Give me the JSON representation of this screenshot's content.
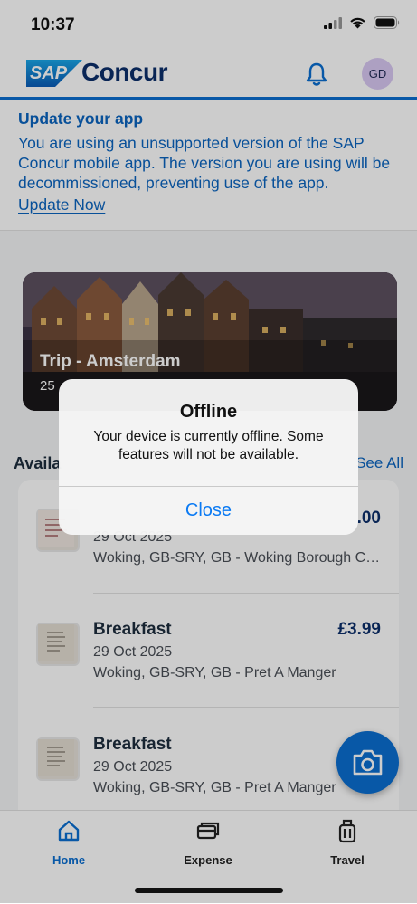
{
  "status_bar": {
    "time": "10:37"
  },
  "header": {
    "brand": "Concur",
    "logo_text": "SAP",
    "avatar_initials": "GD"
  },
  "banner": {
    "title": "Update your app",
    "body": "You are using an unsupported version of the SAP Concur mobile app. The version you are using will be decommissioned, preventing use of the app.",
    "link": "Update Now"
  },
  "trip": {
    "title": "Trip - Amsterdam",
    "date_partial": "25"
  },
  "available": {
    "title_partial": "Availa",
    "see_all": "See All"
  },
  "expenses": [
    {
      "title": "",
      "date": "29 Oct 2025",
      "location": "Woking, GB-SRY, GB - Woking Borough Council",
      "amount": ".00"
    },
    {
      "title": "Breakfast",
      "date": "29 Oct 2025",
      "location": "Woking, GB-SRY, GB - Pret A Manger",
      "amount": "£3.99"
    },
    {
      "title": "Breakfast",
      "date": "29 Oct 2025",
      "location": "Woking, GB-SRY, GB - Pret A Manger",
      "amount": "£"
    }
  ],
  "tabs": [
    {
      "label": "Home",
      "icon": "home-icon",
      "active": true
    },
    {
      "label": "Expense",
      "icon": "card-icon",
      "active": false
    },
    {
      "label": "Travel",
      "icon": "suitcase-icon",
      "active": false
    }
  ],
  "alert": {
    "title": "Offline",
    "message": "Your device is currently offline.  Some features will not be available.",
    "button": "Close"
  },
  "colors": {
    "accent": "#0a6ed1",
    "brand_navy": "#0c2f6b",
    "link_blue": "#0a64c0",
    "ios_blue": "#0a7af3"
  }
}
